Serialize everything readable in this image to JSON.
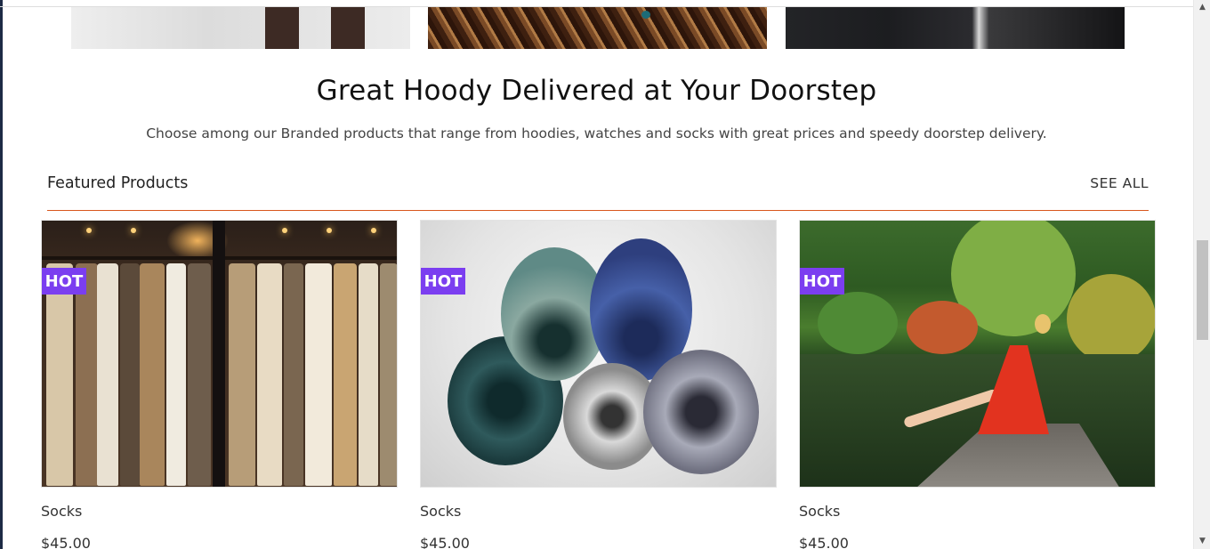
{
  "hero": {
    "title": "Great Hoody Delivered at Your Doorstep",
    "subtitle": "Choose among our Branded products that range from hoodies, watches and socks with great prices and speedy doorstep delivery."
  },
  "featured": {
    "title": "Featured Products",
    "see_all": "SEE ALL",
    "products": [
      {
        "badge": "HOT",
        "name": "Socks",
        "price": "$45.00"
      },
      {
        "badge": "HOT",
        "name": "Socks",
        "price": "$45.00"
      },
      {
        "badge": "HOT",
        "name": "Socks",
        "price": "$45.00"
      }
    ]
  },
  "colors": {
    "badge": "#7b3ef0",
    "divider": "#d9571d"
  },
  "scrollbar": {
    "up_icon": "chevron-up-icon",
    "down_icon": "chevron-down-icon"
  }
}
